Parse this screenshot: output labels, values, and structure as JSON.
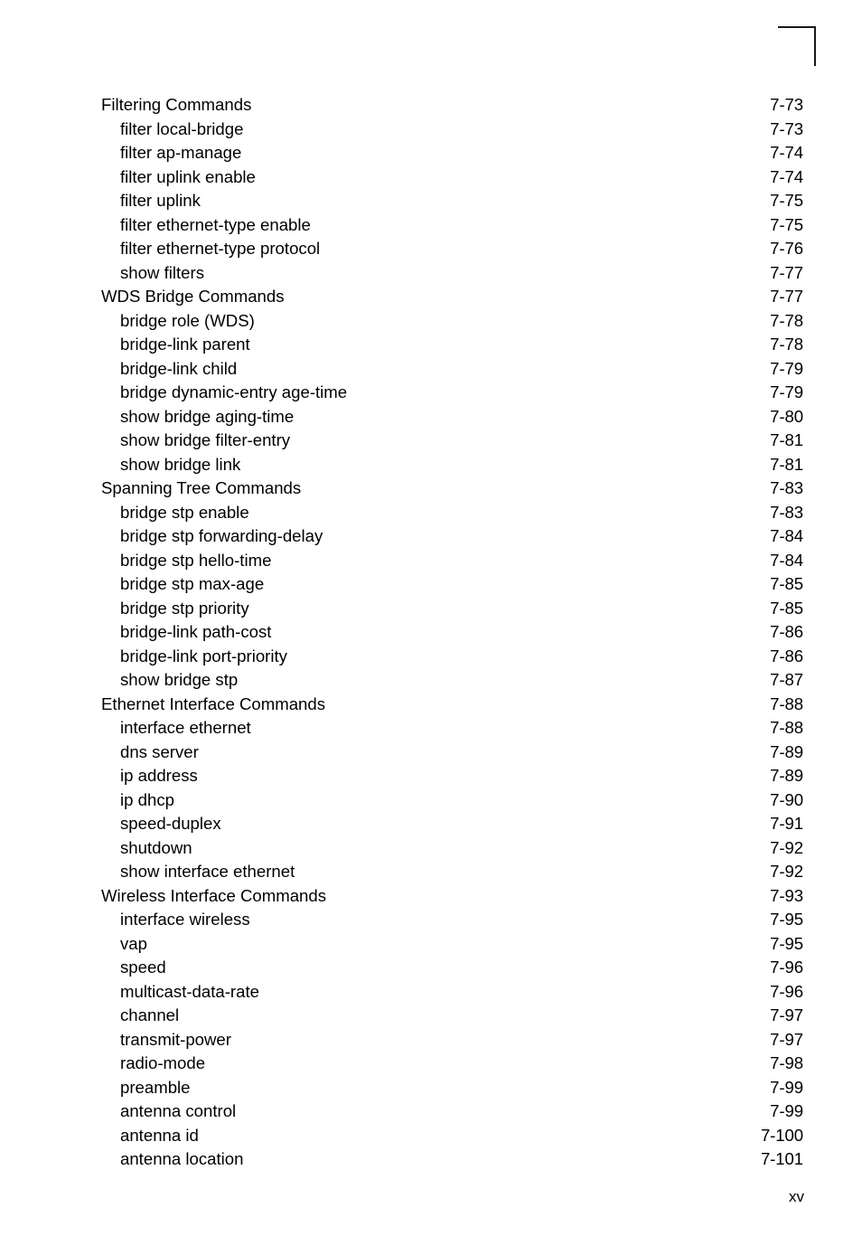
{
  "document": {
    "page_label": "xv",
    "corner_mark": "corner-registration-mark"
  },
  "toc": {
    "entries": [
      {
        "level": 1,
        "title": "Filtering Commands",
        "page": "7-73"
      },
      {
        "level": 2,
        "title": "filter local-bridge",
        "page": "7-73"
      },
      {
        "level": 2,
        "title": "filter ap-manage",
        "page": "7-74"
      },
      {
        "level": 2,
        "title": "filter uplink enable",
        "page": "7-74"
      },
      {
        "level": 2,
        "title": "filter uplink",
        "page": "7-75"
      },
      {
        "level": 2,
        "title": "filter ethernet-type enable",
        "page": "7-75"
      },
      {
        "level": 2,
        "title": "filter ethernet-type protocol",
        "page": "7-76"
      },
      {
        "level": 2,
        "title": "show filters",
        "page": "7-77"
      },
      {
        "level": 1,
        "title": "WDS Bridge Commands",
        "page": "7-77"
      },
      {
        "level": 2,
        "title": "bridge role (WDS)",
        "page": "7-78"
      },
      {
        "level": 2,
        "title": "bridge-link parent",
        "page": "7-78"
      },
      {
        "level": 2,
        "title": "bridge-link child",
        "page": "7-79"
      },
      {
        "level": 2,
        "title": "bridge dynamic-entry age-time",
        "page": "7-79"
      },
      {
        "level": 2,
        "title": "show bridge aging-time",
        "page": "7-80"
      },
      {
        "level": 2,
        "title": "show bridge filter-entry",
        "page": "7-81"
      },
      {
        "level": 2,
        "title": "show bridge link",
        "page": "7-81"
      },
      {
        "level": 1,
        "title": "Spanning Tree Commands",
        "page": "7-83"
      },
      {
        "level": 2,
        "title": "bridge stp enable",
        "page": "7-83"
      },
      {
        "level": 2,
        "title": "bridge stp forwarding-delay",
        "page": "7-84"
      },
      {
        "level": 2,
        "title": "bridge stp hello-time",
        "page": "7-84"
      },
      {
        "level": 2,
        "title": "bridge stp max-age",
        "page": "7-85"
      },
      {
        "level": 2,
        "title": "bridge stp priority",
        "page": "7-85"
      },
      {
        "level": 2,
        "title": "bridge-link path-cost",
        "page": "7-86"
      },
      {
        "level": 2,
        "title": "bridge-link port-priority",
        "page": "7-86"
      },
      {
        "level": 2,
        "title": "show bridge stp",
        "page": "7-87"
      },
      {
        "level": 1,
        "title": "Ethernet Interface Commands",
        "page": "7-88"
      },
      {
        "level": 2,
        "title": "interface ethernet",
        "page": "7-88"
      },
      {
        "level": 2,
        "title": "dns server",
        "page": "7-89"
      },
      {
        "level": 2,
        "title": "ip address",
        "page": "7-89"
      },
      {
        "level": 2,
        "title": "ip dhcp",
        "page": "7-90"
      },
      {
        "level": 2,
        "title": "speed-duplex",
        "page": "7-91"
      },
      {
        "level": 2,
        "title": "shutdown",
        "page": "7-92"
      },
      {
        "level": 2,
        "title": "show interface ethernet",
        "page": "7-92"
      },
      {
        "level": 1,
        "title": "Wireless Interface Commands",
        "page": "7-93"
      },
      {
        "level": 2,
        "title": "interface wireless",
        "page": "7-95"
      },
      {
        "level": 2,
        "title": "vap",
        "page": "7-95"
      },
      {
        "level": 2,
        "title": "speed",
        "page": "7-96"
      },
      {
        "level": 2,
        "title": "multicast-data-rate",
        "page": "7-96"
      },
      {
        "level": 2,
        "title": "channel",
        "page": "7-97"
      },
      {
        "level": 2,
        "title": "transmit-power",
        "page": "7-97"
      },
      {
        "level": 2,
        "title": "radio-mode",
        "page": "7-98"
      },
      {
        "level": 2,
        "title": "preamble",
        "page": "7-99"
      },
      {
        "level": 2,
        "title": "antenna control",
        "page": "7-99"
      },
      {
        "level": 2,
        "title": "antenna id",
        "page": "7-100"
      },
      {
        "level": 2,
        "title": "antenna location",
        "page": "7-101"
      }
    ]
  }
}
